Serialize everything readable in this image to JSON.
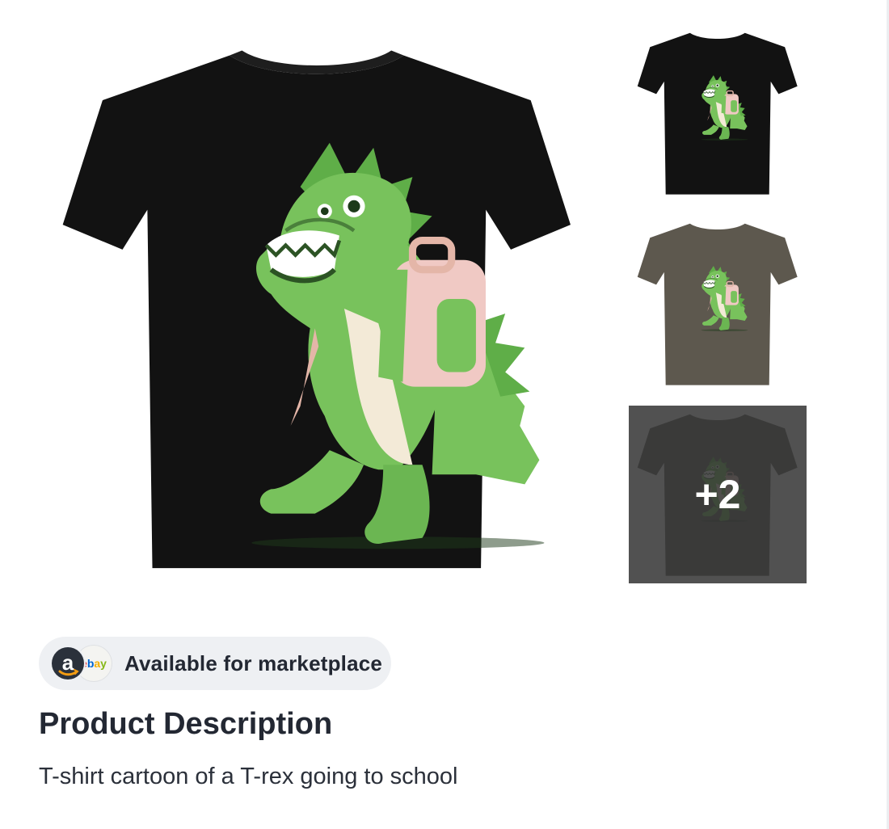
{
  "product": {
    "main_image_alt": "T-shirt cartoon of a T-rex going to school",
    "variants": [
      {
        "shirt_color": "#121212"
      },
      {
        "shirt_color": "#5d584e"
      },
      {
        "shirt_color": "#5a5a58"
      }
    ],
    "more_images_label": "+2"
  },
  "marketplace": {
    "label": "Available for marketplace",
    "amazon_icon": "amazon-a-icon",
    "ebay_icon": "ebay-logo-icon",
    "ebay_text": "ebay"
  },
  "description": {
    "title": "Product Description",
    "text": "T-shirt cartoon of a T-rex going to school"
  },
  "colors": {
    "dino_green": "#78c25c",
    "dino_dark": "#4f9a3e",
    "backpack": "#f0c9c4",
    "pill_bg": "#eef0f3"
  }
}
